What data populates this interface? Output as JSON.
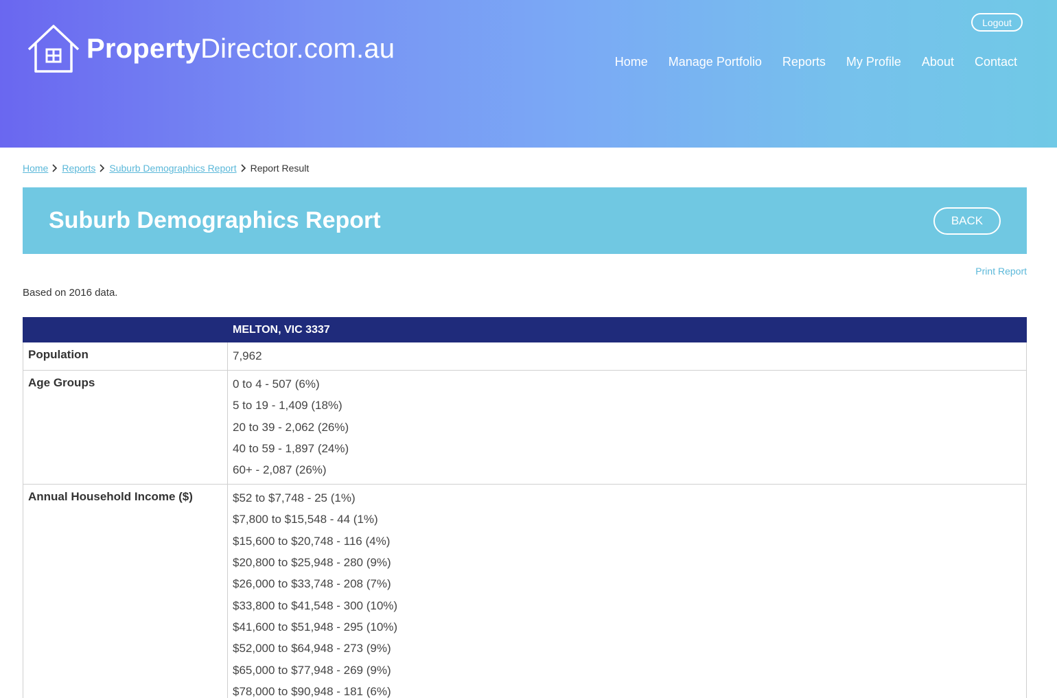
{
  "brand": {
    "name_bold": "Property",
    "name_rest": "Director.com.au"
  },
  "header": {
    "logout_label": "Logout",
    "nav": [
      "Home",
      "Manage Portfolio",
      "Reports",
      "My Profile",
      "About",
      "Contact"
    ]
  },
  "breadcrumb": {
    "items": [
      "Home",
      "Reports",
      "Suburb Demographics Report"
    ],
    "current": "Report Result"
  },
  "banner": {
    "title": "Suburb Demographics Report",
    "back_label": "BACK"
  },
  "print_label": "Print Report",
  "note": "Based on 2016 data.",
  "table": {
    "header": [
      "",
      "MELTON, VIC 3337"
    ],
    "rows": [
      {
        "label": "Population",
        "values": [
          "7,962"
        ]
      },
      {
        "label": "Age Groups",
        "values": [
          "0 to 4 - 507 (6%)",
          "5 to 19 - 1,409 (18%)",
          "20 to 39 - 2,062 (26%)",
          "40 to 59 - 1,897 (24%)",
          "60+ - 2,087 (26%)"
        ]
      },
      {
        "label": "Annual Household Income ($)",
        "values": [
          "$52 to $7,748 - 25 (1%)",
          "$7,800 to $15,548 - 44 (1%)",
          "$15,600 to $20,748 - 116 (4%)",
          "$20,800 to $25,948 - 280 (9%)",
          "$26,000 to $33,748 - 208 (7%)",
          "$33,800 to $41,548 - 300 (10%)",
          "$41,600 to $51,948 - 295 (10%)",
          "$52,000 to $64,948 - 273 (9%)",
          "$65,000 to $77,948 - 269 (9%)",
          "$78,000 to $90,948 - 181 (6%)"
        ]
      }
    ]
  },
  "colors": {
    "table_header": "#1f2b7b",
    "banner": "#70c8e2",
    "link": "#5bb8d9",
    "header_gradient_start": "#6a67f0",
    "header_gradient_end": "#70c9e6"
  }
}
